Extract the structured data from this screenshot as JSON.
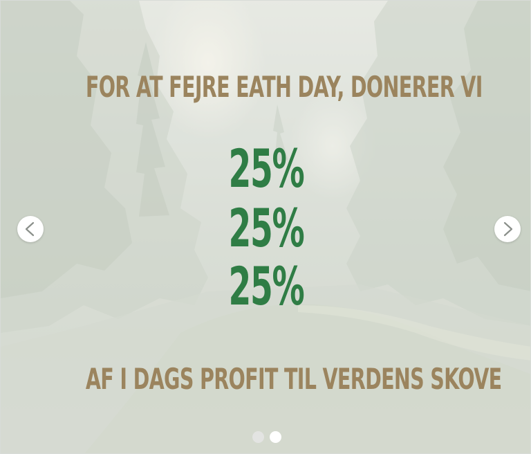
{
  "slide": {
    "headline_top": "FOR AT FEJRE EATH DAY, DONERER VI",
    "percent_lines": [
      "25%",
      "25%",
      "25%"
    ],
    "headline_bottom": "AF I DAGS PROFIT TIL VERDENS SKOVE"
  },
  "carousel": {
    "prev_icon": "chevron-left-icon",
    "next_icon": "chevron-right-icon",
    "slide_count": 2,
    "active_slide": 2
  },
  "colors": {
    "headline": "#9b845e",
    "percent": "#2f7d45",
    "background": "#d3d8cf"
  }
}
